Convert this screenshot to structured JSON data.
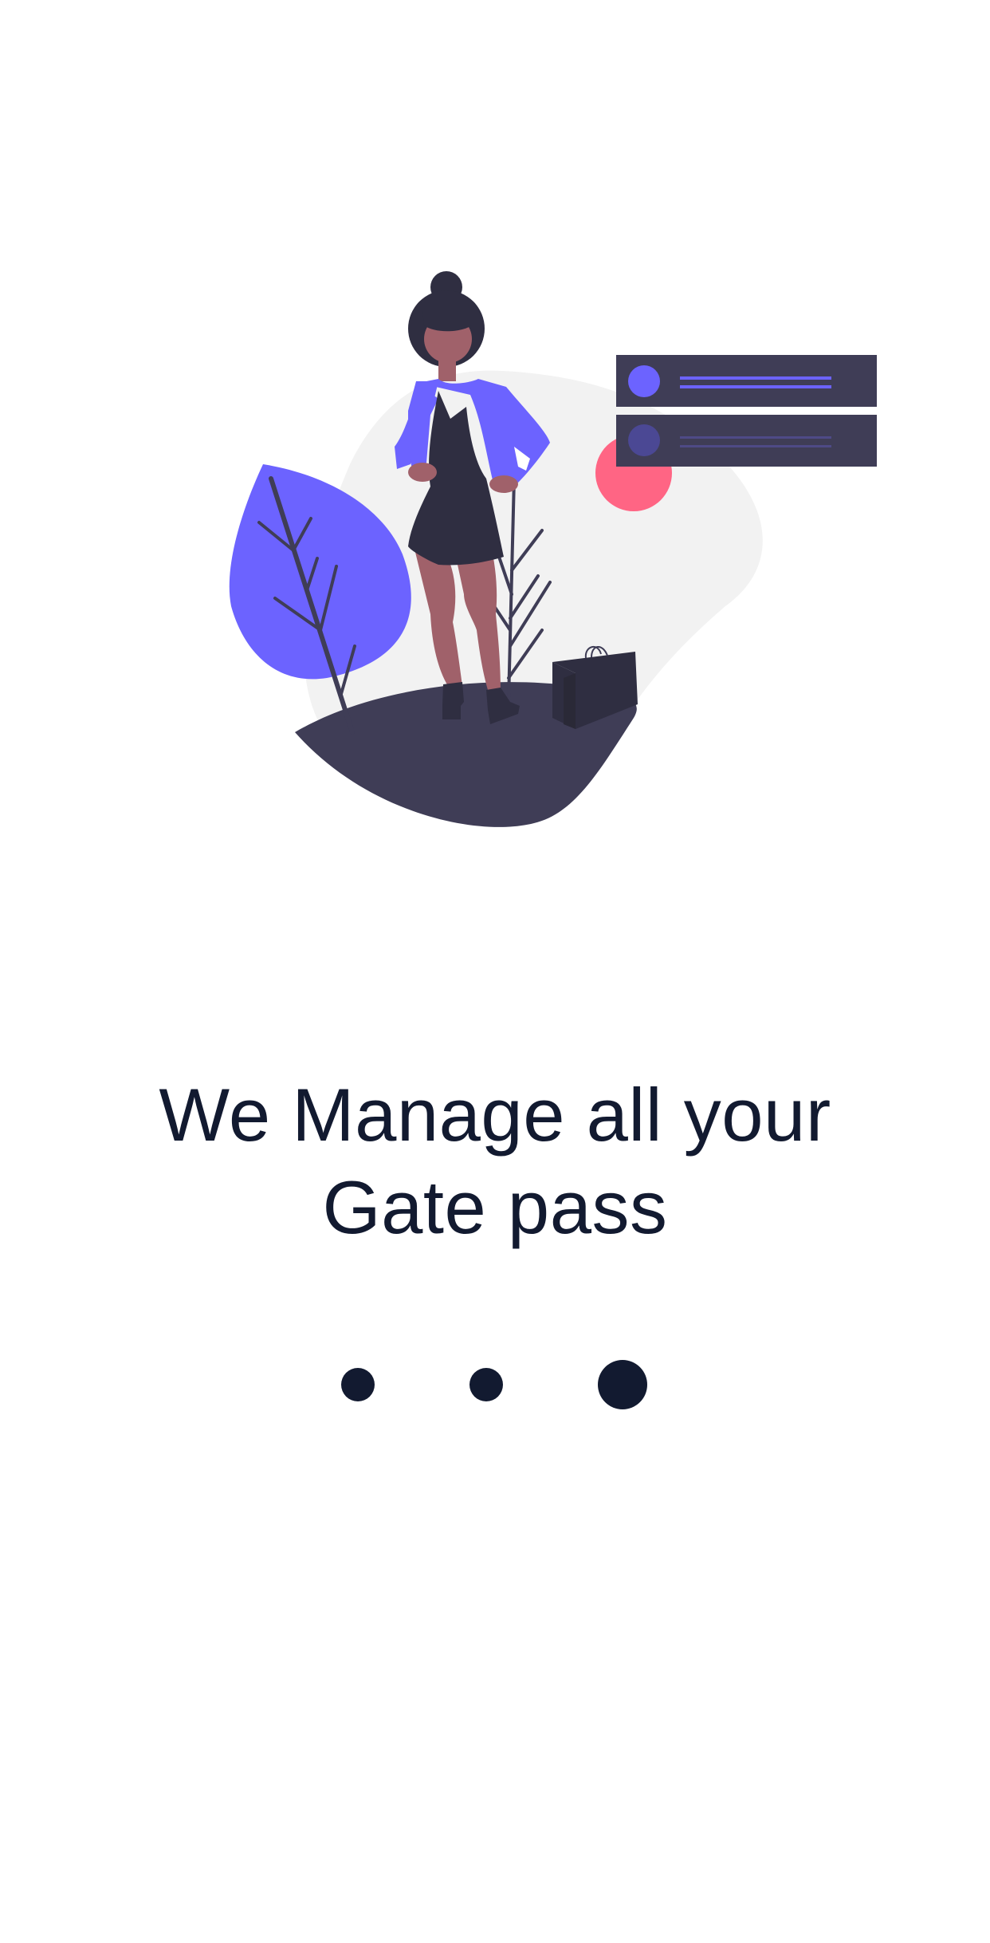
{
  "onboarding": {
    "headline": "We Manage all your Gate pass",
    "illustration": {
      "icon": "woman-shopping-illustration",
      "colors": {
        "primary": "#6c63ff",
        "dark": "#3f3d56",
        "darker": "#2f2e41",
        "accent": "#ff6584",
        "blob": "#f2f2f2",
        "skin": "#a0616a"
      }
    },
    "pagination": {
      "total": 3,
      "active": 3
    },
    "text_color": "#121a30"
  }
}
